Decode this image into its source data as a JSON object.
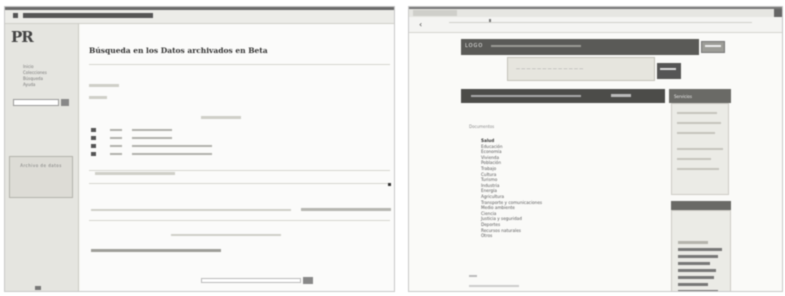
{
  "left_window": {
    "logo": "PR",
    "title": "Búsqueda en los Datos archivados en Beta",
    "sidebar_links": [
      "Inicio",
      "Colecciones",
      "Búsqueda",
      "Ayuda"
    ],
    "sidebar_box_text": "Archivo de datos"
  },
  "right_window": {
    "header_brand": "LOGO",
    "sidebar_head": "Servicios",
    "list_heading": "Documentos",
    "list_items": [
      "Salud",
      "Educación",
      "Economía",
      "Vivienda",
      "Población",
      "Trabajo",
      "Cultura",
      "Turismo",
      "Industria",
      "Energía",
      "Agricultura",
      "Transporte y comunicaciones",
      "Medio ambiente",
      "Ciencia",
      "Justicia y seguridad",
      "Deportes",
      "Recursos naturales",
      "Otros"
    ]
  }
}
